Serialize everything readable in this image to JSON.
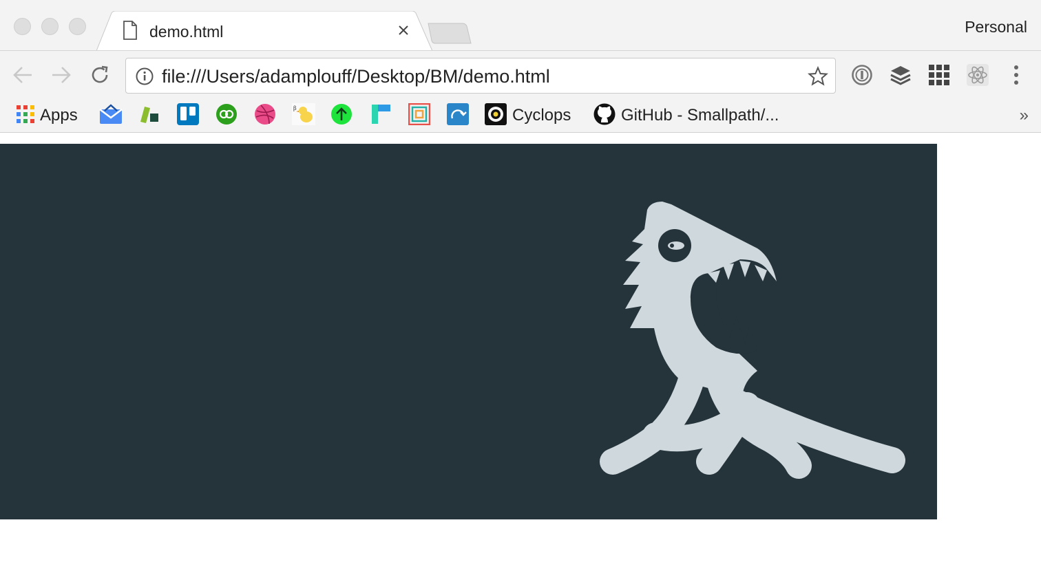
{
  "window": {
    "tab_title": "demo.html",
    "profile_name": "Personal"
  },
  "toolbar": {
    "url": "file:///Users/adamplouff/Desktop/BM/demo.html"
  },
  "bookmarks": {
    "apps_label": "Apps",
    "cyclops_label": "Cyclops",
    "github_label": "GitHub - Smallpath/...",
    "overflow_label": "»"
  },
  "content": {
    "background_color": "#25333b",
    "illustration_color": "#cfd8dc"
  }
}
